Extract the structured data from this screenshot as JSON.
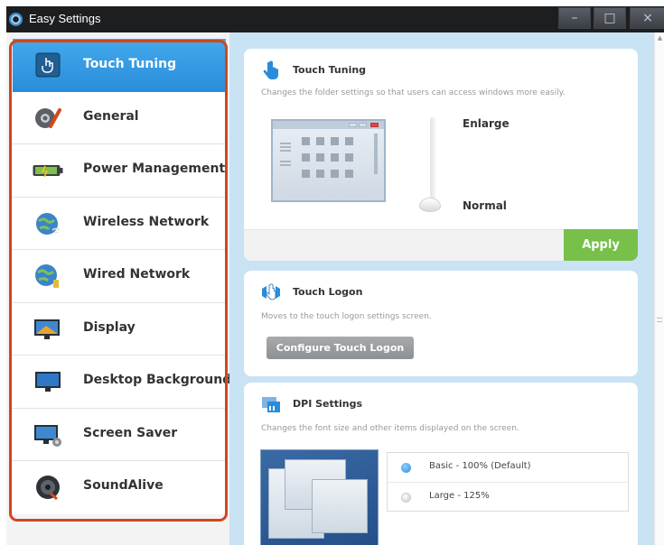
{
  "window": {
    "title": "Easy Settings",
    "controls": {
      "minimize": "–",
      "maximize": "□",
      "close": "×"
    }
  },
  "colors": {
    "accent": "#2a8ddb",
    "highlight_border": "#d0461f",
    "apply_green": "#77c04a",
    "pane_bg": "#c9e2f4"
  },
  "sidebar": {
    "items": [
      {
        "label": "Touch Tuning",
        "icon": "touch-hand-icon",
        "active": true
      },
      {
        "label": "General",
        "icon": "gear-wrench-icon"
      },
      {
        "label": "Power Management",
        "icon": "battery-icon"
      },
      {
        "label": "Wireless Network",
        "icon": "wireless-globe-icon"
      },
      {
        "label": "Wired Network",
        "icon": "wired-globe-icon"
      },
      {
        "label": "Display",
        "icon": "display-icon"
      },
      {
        "label": "Desktop Background",
        "icon": "desktop-background-icon"
      },
      {
        "label": "Screen Saver",
        "icon": "screen-saver-icon"
      },
      {
        "label": "SoundAlive",
        "icon": "speaker-icon"
      }
    ]
  },
  "touch_tuning": {
    "title": "Touch Tuning",
    "description": "Changes the folder settings so that users can access windows more easily.",
    "slider_top_label": "Enlarge",
    "slider_bottom_label": "Normal",
    "slider_position": "Normal",
    "apply_label": "Apply"
  },
  "touch_logon": {
    "title": "Touch Logon",
    "description": "Moves to the touch logon settings screen.",
    "button_label": "Configure Touch Logon"
  },
  "dpi": {
    "title": "DPI Settings",
    "description": "Changes the font size and other items displayed on the screen.",
    "options": [
      {
        "label": "Basic - 100% (Default)",
        "selected": true
      },
      {
        "label": "Large - 125%",
        "selected": false
      }
    ]
  }
}
